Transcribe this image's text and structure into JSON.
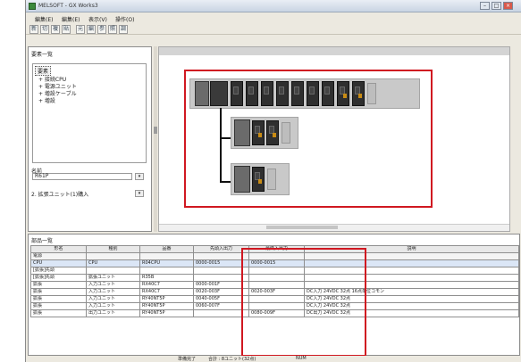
{
  "window": {
    "title": "MELSOFT - GX Works3"
  },
  "menu": [
    "編集(E)",
    "編集(E)",
    "表示(V)",
    "操作(O)"
  ],
  "toolbar": [
    "新",
    "切",
    "複",
    "貼",
    "元",
    "編",
    "参",
    "照",
    "調"
  ],
  "left": {
    "title": "要素一覧",
    "tree_root": "要素",
    "tree_items": [
      "+ 接続CPU",
      "+ 電源ユニット",
      "+ 増設ケーブル",
      "+ 増設"
    ],
    "prop_label": "名前",
    "prop_value": "R61P",
    "desc_text": "2. 拡張ユニット(1)購入"
  },
  "bottom": {
    "title": "部品一覧",
    "headers": [
      "形名",
      "種別",
      "品番",
      "先頭入出力",
      "最終入出力",
      "説明"
    ],
    "rows": [
      {
        "cls": "group",
        "cells": [
          "電源",
          "",
          "",
          "",
          "",
          ""
        ]
      },
      {
        "cls": "sel",
        "cells": [
          "CPU",
          "CPU",
          "R04CPU",
          "0000-0015",
          "0000-0015",
          ""
        ]
      },
      {
        "cls": "",
        "cells": [
          "[拡張]先頭",
          "",
          "",
          "",
          "",
          ""
        ]
      },
      {
        "cls": "",
        "cells": [
          "[拡張]先頭",
          "拡張ユニット",
          "R35B",
          "",
          "",
          ""
        ]
      },
      {
        "cls": "",
        "cells": [
          "拡張",
          "入力ユニット",
          "RX40C7",
          "0000-001F",
          "",
          ""
        ]
      },
      {
        "cls": "",
        "cells": [
          "拡張",
          "入力ユニット",
          "RX40C7",
          "0020-003F",
          "0020-003F",
          "DC入力 24VDC 32点 16点単位コモン"
        ]
      },
      {
        "cls": "",
        "cells": [
          "拡張",
          "入力ユニット",
          "RY40NT5P",
          "0040-005F",
          "",
          "DC入力 24VDC 32点"
        ]
      },
      {
        "cls": "",
        "cells": [
          "拡張",
          "入力ユニット",
          "RY40NT5P",
          "0060-007F",
          "",
          "DC入力 24VDC 32点"
        ]
      },
      {
        "cls": "",
        "cells": [
          "拡張",
          "出力ユニット",
          "RY40NT5P",
          "",
          "0080-009F",
          "DC出力 24VDC 32点"
        ]
      }
    ]
  },
  "status": {
    "left": "準備完了",
    "mid": "合計 : 8ユニット(32点)",
    "right": "NUM"
  },
  "colors": {
    "accent": "#d01821"
  }
}
